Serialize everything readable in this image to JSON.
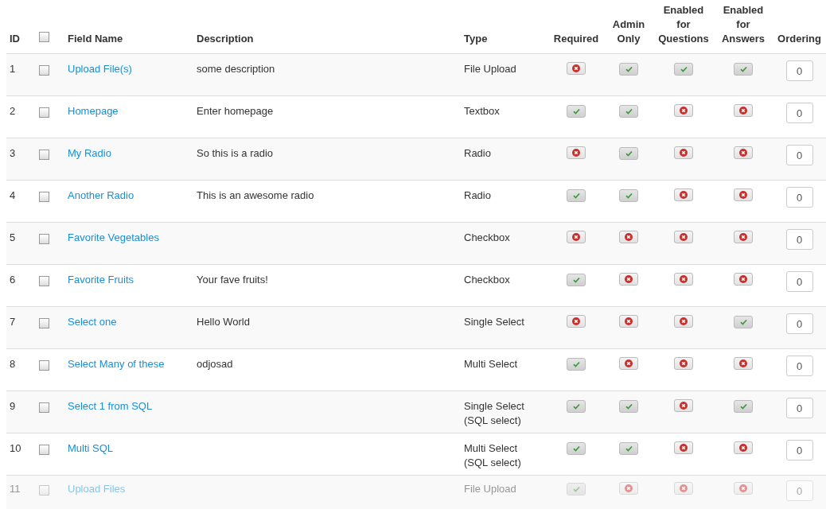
{
  "table": {
    "columns": [
      {
        "label": "ID",
        "kind": "text"
      },
      {
        "kind": "checkbox"
      },
      {
        "label": "Field Name",
        "kind": "text"
      },
      {
        "label": "Description",
        "kind": "text"
      },
      {
        "label": "Type",
        "kind": "text"
      },
      {
        "label": "Required",
        "kind": "toggle"
      },
      {
        "label": "Admin Only",
        "kind": "toggle"
      },
      {
        "label": "Enabled for Questions",
        "kind": "toggle"
      },
      {
        "label": "Enabled for Answers",
        "kind": "toggle"
      },
      {
        "label": "Ordering",
        "kind": "input"
      }
    ],
    "header_checkbox": {
      "checked": false
    },
    "rows": [
      {
        "id": "1",
        "checked": false,
        "name": "Upload File(s)",
        "description": "some description",
        "type": "File Upload",
        "required": false,
        "admin_only": true,
        "questions": true,
        "answers": true,
        "ordering": "0",
        "faded": false
      },
      {
        "id": "2",
        "checked": false,
        "name": "Homepage",
        "description": "Enter homepage",
        "type": "Textbox",
        "required": true,
        "admin_only": true,
        "questions": false,
        "answers": false,
        "ordering": "0",
        "faded": false
      },
      {
        "id": "3",
        "checked": false,
        "name": "My Radio",
        "description": "So this is a radio",
        "type": "Radio",
        "required": false,
        "admin_only": true,
        "questions": false,
        "answers": false,
        "ordering": "0",
        "faded": false
      },
      {
        "id": "4",
        "checked": false,
        "name": "Another Radio",
        "description": "This is an awesome radio",
        "type": "Radio",
        "required": true,
        "admin_only": true,
        "questions": false,
        "answers": false,
        "ordering": "0",
        "faded": false
      },
      {
        "id": "5",
        "checked": false,
        "name": "Favorite Vegetables",
        "description": "",
        "type": "Checkbox",
        "required": false,
        "admin_only": false,
        "questions": false,
        "answers": false,
        "ordering": "0",
        "faded": false
      },
      {
        "id": "6",
        "checked": false,
        "name": "Favorite Fruits",
        "description": "Your fave fruits!",
        "type": "Checkbox",
        "required": true,
        "admin_only": false,
        "questions": false,
        "answers": false,
        "ordering": "0",
        "faded": false
      },
      {
        "id": "7",
        "checked": false,
        "name": "Select one",
        "description": "Hello World",
        "type": "Single Select",
        "required": false,
        "admin_only": false,
        "questions": false,
        "answers": true,
        "ordering": "0",
        "faded": false
      },
      {
        "id": "8",
        "checked": false,
        "name": "Select Many of these",
        "description": "odjosad",
        "type": "Multi Select",
        "required": true,
        "admin_only": false,
        "questions": false,
        "answers": false,
        "ordering": "0",
        "faded": false
      },
      {
        "id": "9",
        "checked": false,
        "name": "Select 1 from SQL",
        "description": "",
        "type": "Single Select (SQL select)",
        "required": true,
        "admin_only": true,
        "questions": false,
        "answers": true,
        "ordering": "0",
        "faded": false
      },
      {
        "id": "10",
        "checked": false,
        "name": "Multi SQL",
        "description": "",
        "type": "Multi Select (SQL select)",
        "required": true,
        "admin_only": true,
        "questions": false,
        "answers": false,
        "ordering": "0",
        "faded": false
      },
      {
        "id": "11",
        "checked": false,
        "name": "Upload Files",
        "description": "",
        "type": "File Upload",
        "required": true,
        "admin_only": false,
        "questions": false,
        "answers": false,
        "ordering": "0",
        "faded": true
      }
    ]
  }
}
